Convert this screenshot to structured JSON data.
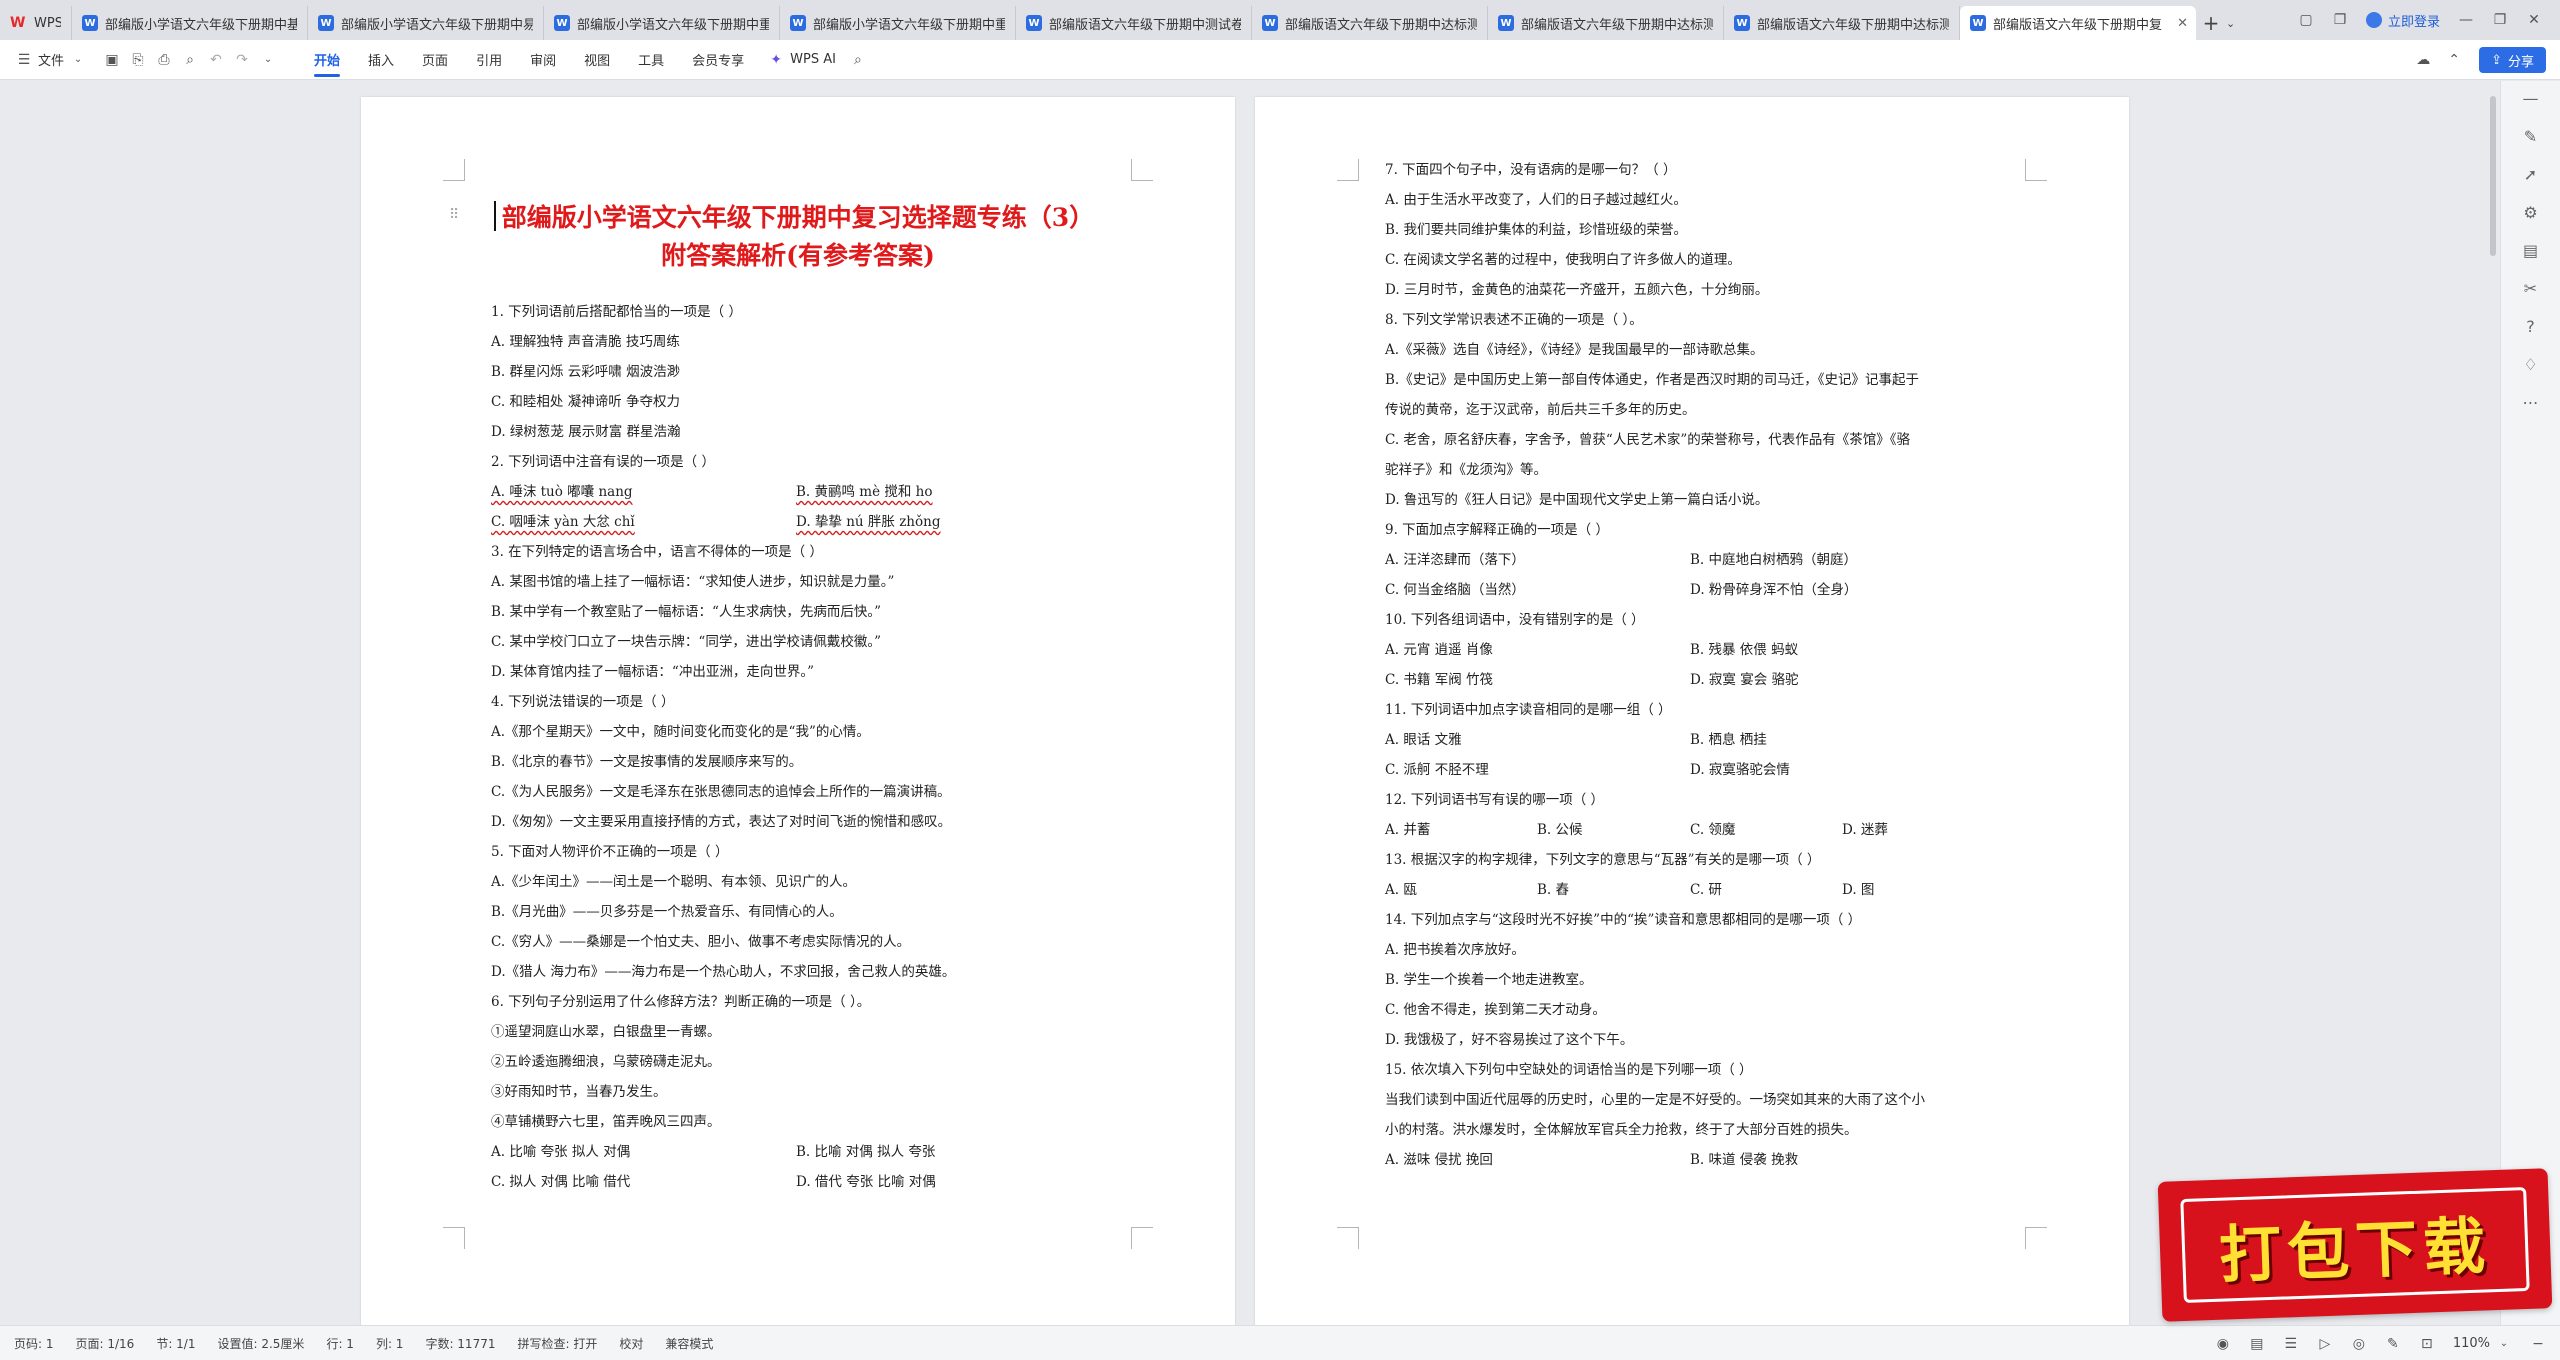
{
  "tabs": {
    "home_label": "WPS",
    "items": [
      {
        "label": "部编版小学语文六年级下册期中基础"
      },
      {
        "label": "部编版小学语文六年级下册期中易错"
      },
      {
        "label": "部编版小学语文六年级下册期中重难"
      },
      {
        "label": "部编版小学语文六年级下册期中重难"
      },
      {
        "label": "部编版语文六年级下册期中测试卷"
      },
      {
        "label": "部编版语文六年级下册期中达标测试"
      },
      {
        "label": "部编版语文六年级下册期中达标测试"
      },
      {
        "label": "部编版语文六年级下册期中达标测试"
      }
    ],
    "active_label": "部编版语文六年级下册期中复",
    "login": "立即登录"
  },
  "toolbar": {
    "file": "文件",
    "menus": [
      "开始",
      "插入",
      "页面",
      "引用",
      "审阅",
      "视图",
      "工具",
      "会员专享"
    ],
    "active_menu": "开始",
    "wps_ai": "WPS AI",
    "share": "分享"
  },
  "accent": "#1e63e6",
  "title_color": "#e0191b",
  "doc": {
    "title_line1": "部编版小学语文六年级下册期中复习选择题专练（3）",
    "title_line2": "附答案解析(有参考答案)",
    "left": {
      "q1": "1. 下列词语前后搭配都恰当的一项是（    ）",
      "q1a": "A. 理解独特    声音清脆    技巧周练",
      "q1b": "B. 群星闪烁    云彩呼啸    烟波浩渺",
      "q1c": "C. 和睦相处    凝神谛听    争夺权力",
      "q1d": "D. 绿树葱茏    展示财富    群星浩瀚",
      "q2": "2. 下列词语中注音有误的一项是（    ）",
      "q2a": "A. 唾沫 tuò    嘟囔 nang",
      "q2b": "B. 黄鹂鸣 mè    搅和 ho",
      "q2c": "C. 咽唾沫 yàn    大忿 chǐ",
      "q2d": "D. 挚挚 nú    胖胀 zhǒng",
      "q3": "3. 在下列特定的语言场合中，语言不得体的一项是（    ）",
      "q3a": "A. 某图书馆的墙上挂了一幅标语：“求知使人进步，知识就是力量。”",
      "q3b": "B. 某中学有一个教室贴了一幅标语：“人生求病快，先病而后快。”",
      "q3c": "C. 某中学校门口立了一块告示牌：“同学，进出学校请佩戴校徽。”",
      "q3d": "D. 某体育馆内挂了一幅标语：“冲出亚洲，走向世界。”",
      "q4": "4. 下列说法错误的一项是（    ）",
      "q4a": "A.《那个星期天》一文中，随时间变化而变化的是“我”的心情。",
      "q4b": "B.《北京的春节》一文是按事情的发展顺序来写的。",
      "q4c": "C.《为人民服务》一文是毛泽东在张思德同志的追悼会上所作的一篇演讲稿。",
      "q4d": "D.《匆匆》一文主要采用直接抒情的方式，表达了对时间飞逝的惋惜和感叹。",
      "q5": "5. 下面对人物评价不正确的一项是（    ）",
      "q5a": "A.《少年闰土》——闰土是一个聪明、有本领、见识广的人。",
      "q5b": "B.《月光曲》——贝多芬是一个热爱音乐、有同情心的人。",
      "q5c": "C.《穷人》——桑娜是一个怕丈夫、胆小、做事不考虑实际情况的人。",
      "q5d": "D.《猎人 海力布》——海力布是一个热心助人，不求回报，舍己救人的英雄。",
      "q6": "6. 下列句子分别运用了什么修辞方法？判断正确的一项是（    ）。",
      "q6_1": "①遥望洞庭山水翠，白银盘里一青螺。",
      "q6_2": "②五岭逶迤腾细浪，乌蒙磅礴走泥丸。",
      "q6_3": "③好雨知时节，当春乃发生。",
      "q6_4": "④草铺横野六七里，笛弄晚风三四声。",
      "q6a": "A. 比喻  夸张  拟人  对偶",
      "q6b": "B. 比喻  对偶  拟人  夸张",
      "q6c": "C. 拟人  对偶  比喻  借代",
      "q6d": "D. 借代  夸张  比喻  对偶"
    },
    "right": {
      "q7": "7. 下面四个句子中，没有语病的是哪一句？（    ）",
      "q7a": "A. 由于生活水平改变了，人们的日子越过越红火。",
      "q7b": "B. 我们要共同维护集体的利益，珍惜班级的荣誉。",
      "q7c": "C. 在阅读文学名著的过程中，使我明白了许多做人的道理。",
      "q7d": "D. 三月时节，金黄色的油菜花一齐盛开，五颜六色，十分绚丽。",
      "q8": "8. 下列文学常识表述不正确的一项是（    ）。",
      "q8a": "A.《采薇》选自《诗经》，《诗经》是我国最早的一部诗歌总集。",
      "q8b1": "B.《史记》是中国历史上第一部自传体通史，作者是西汉时期的司马迁，《史记》记事起于",
      "q8b2": "传说的黄帝，迄于汉武帝，前后共三千多年的历史。",
      "q8c1": "C. 老舍，原名舒庆春，字舍予，曾获“人民艺术家”的荣誉称号，代表作品有《茶馆》《骆",
      "q8c2": "驼祥子》和《龙须沟》等。",
      "q8d": "D. 鲁迅写的《狂人日记》是中国现代文学史上第一篇白话小说。",
      "q9": "9. 下面加点字解释正确的一项是（    ）",
      "q9a": "A. 汪洋恣肆而（落下）",
      "q9b": "B. 中庭地白树栖鸦（朝庭）",
      "q9c": "C. 何当金络脑（当然）",
      "q9d": "D. 粉骨碎身浑不怕（全身）",
      "q10": "10. 下列各组词语中，没有错别字的是（    ）",
      "q10a": "A. 元宵      逍遥    肖像",
      "q10b": "B. 残暴      依偎    蚂蚁",
      "q10c": "C. 书籍      军阀    竹筏",
      "q10d": "D. 寂寞      宴会    骆驼",
      "q11": "11. 下列词语中加点字读音相同的是哪一组（    ）",
      "q11a": "A. 眼话  文雅",
      "q11b": "B. 栖息  栖挂",
      "q11c": "C. 派舸  不胫不理",
      "q11d": "D. 寂寞骆驼会情",
      "q12": "12. 下列词语书写有误的哪一项（    ）",
      "q12a": "A. 并蓄",
      "q12b": "B. 公候",
      "q12c": "C. 领魔",
      "q12d": "D. 迷葬",
      "q13": "13. 根据汉字的构字规律，下列文字的意思与“瓦器”有关的是哪一项（    ）",
      "q13a": "A. 瓯",
      "q13b": "B. 舂",
      "q13c": "C. 研",
      "q13d": "D. 图",
      "q14": "14. 下列加点字与“这段时光不好挨”中的“挨”读音和意思都相同的是哪一项（    ）",
      "q14a": "A. 把书挨着次序放好。",
      "q14b": "B. 学生一个挨着一个地走进教室。",
      "q14c": "C. 他舍不得走，挨到第二天才动身。",
      "q14d": "D. 我饿极了，好不容易挨过了这个下午。",
      "q15": "15. 依次填入下列句中空缺处的词语恰当的是下列哪一项（    ）",
      "q15p1": "当我们读到中国近代屈辱的历史时，心里的一定是不好受的。一场突如其来的大雨了这个小",
      "q15p2": "小的村落。洪水爆发时，全体解放军官兵全力抢救，终于了大部分百姓的损失。",
      "q15a": "A. 滋味  侵扰  挽回",
      "q15b": "B. 味道  侵袭  挽救"
    }
  },
  "status": {
    "page_label": "页码: 1",
    "pages": "页面: 1/16",
    "section": "节: 1/1",
    "setting": "设置值: 2.5厘米",
    "row": "行: 1",
    "col": "列: 1",
    "words": "字数: 11771",
    "spell": "拼写检查: 打开",
    "proof": "校对",
    "compat": "兼容模式",
    "zoom": "110%"
  },
  "banner": {
    "text": "打包下载"
  }
}
